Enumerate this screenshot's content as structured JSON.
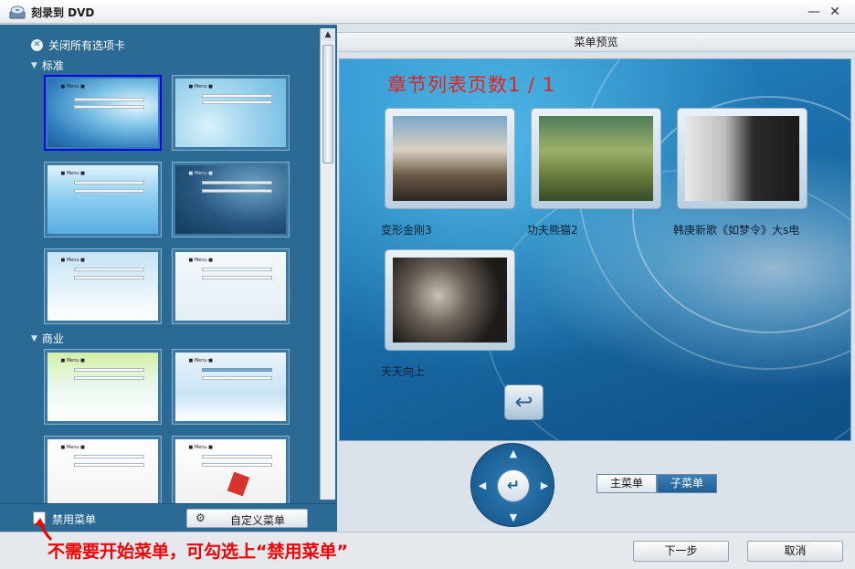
{
  "window": {
    "title": "刻录到 DVD",
    "app_icon": "dvd-drive-icon",
    "minimize_glyph": "—",
    "close_glyph": "✕"
  },
  "left_panel": {
    "close_tabs_label": "关闭所有选项卡",
    "sections": [
      {
        "name": "标准",
        "template_count": 6
      },
      {
        "name": "商业",
        "template_count": 4
      }
    ],
    "disable_menu_label": "禁用菜单",
    "disable_menu_checked": false,
    "custom_menu_label": "自定义菜单"
  },
  "right_panel": {
    "header": "菜单预览",
    "chapter_title": "章节列表页数1 / 1",
    "videos": [
      {
        "label": "变形金刚3"
      },
      {
        "label": "功夫熊猫2"
      },
      {
        "label": "韩庚新歌《如梦令》大s电"
      },
      {
        "label": "天天向上"
      }
    ],
    "return_icon": "return-arrow-icon",
    "nav_ok_glyph": "↵",
    "main_menu_tab": "主菜单",
    "sub_menu_tab": "子菜单",
    "active_tab": "子菜单"
  },
  "bottom": {
    "annotation": "不需要开始菜单，可勾选上“禁用菜单”",
    "next_button": "下一步",
    "cancel_button": "取消"
  },
  "colors": {
    "panel_blue": "#2b6a94",
    "annotation_red": "#f30000",
    "chapter_title_red": "#e8211b",
    "selected_border": "#0000ff"
  }
}
